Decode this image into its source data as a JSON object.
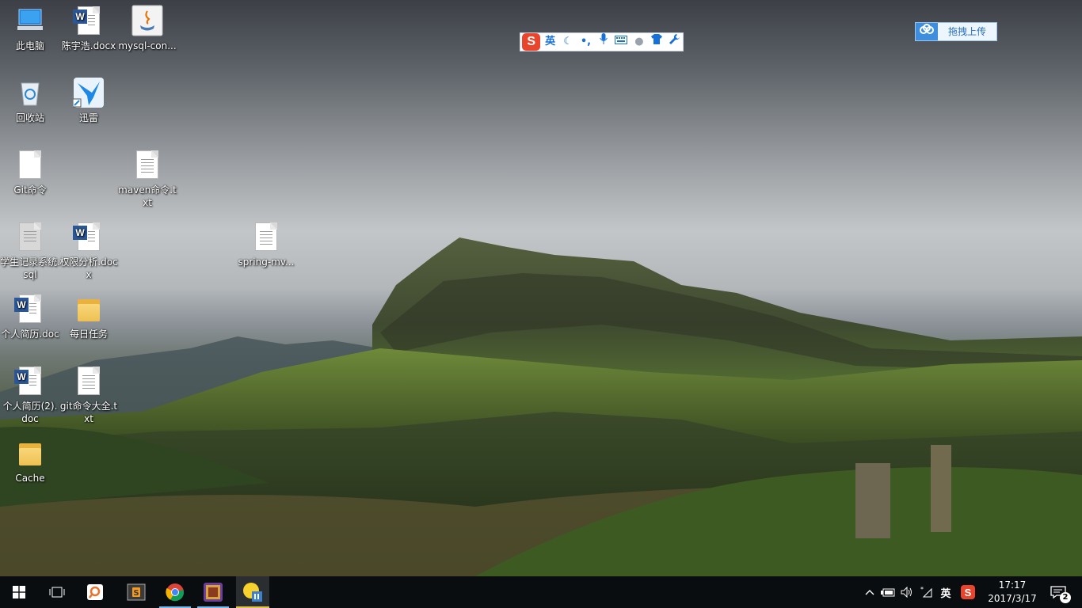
{
  "ime_toolbar": {
    "logo": "S",
    "mode_label": "英",
    "tools": [
      "moon-icon",
      "punctuation-icon",
      "microphone-icon",
      "keyboard-icon",
      "user-icon",
      "skin-icon",
      "wrench-icon"
    ]
  },
  "upload_widget": {
    "label": "拖拽上传",
    "icon": "cloud-icon"
  },
  "desktop_icons": [
    {
      "label": "此电脑",
      "icon": "computer-icon"
    },
    {
      "label": "陈宇浩.docx",
      "icon": "word-doc-icon"
    },
    {
      "label": "mysql-con...",
      "icon": "java-icon"
    },
    {
      "label": "回收站",
      "icon": "recycle-bin-icon"
    },
    {
      "label": "迅雷",
      "icon": "thunder-icon"
    },
    {
      "label": "Git命令",
      "icon": "file-icon"
    },
    {
      "label": "maven命令.txt",
      "icon": "text-file-icon"
    },
    {
      "label": "学生记录系统.sql",
      "icon": "sql-file-icon"
    },
    {
      "label": "权限分析.docx",
      "icon": "word-doc-icon"
    },
    {
      "label": "spring-mv...",
      "icon": "text-file-icon"
    },
    {
      "label": "个人简历.doc",
      "icon": "word-doc-icon"
    },
    {
      "label": "每日任务",
      "icon": "folder-icon"
    },
    {
      "label": "个人简历(2).doc",
      "icon": "word-doc-icon"
    },
    {
      "label": "git命令大全.txt",
      "icon": "text-file-icon"
    },
    {
      "label": "Cache",
      "icon": "folder-icon"
    }
  ],
  "taskbar": {
    "apps": [
      "start-icon",
      "task-view-icon",
      "search-app-icon",
      "sublime-icon",
      "chrome-icon",
      "game-icon",
      "sticky-app-icon"
    ],
    "tray": {
      "input_mode": "英",
      "time": "17:17",
      "date": "2017/3/17",
      "notifications": "2"
    }
  },
  "colors": {
    "taskbar": "#0a0d0f",
    "ime_accent": "#1670d8",
    "ime_logo": "#e8452c",
    "word_blue": "#2b5797",
    "folder": "#eec052"
  }
}
